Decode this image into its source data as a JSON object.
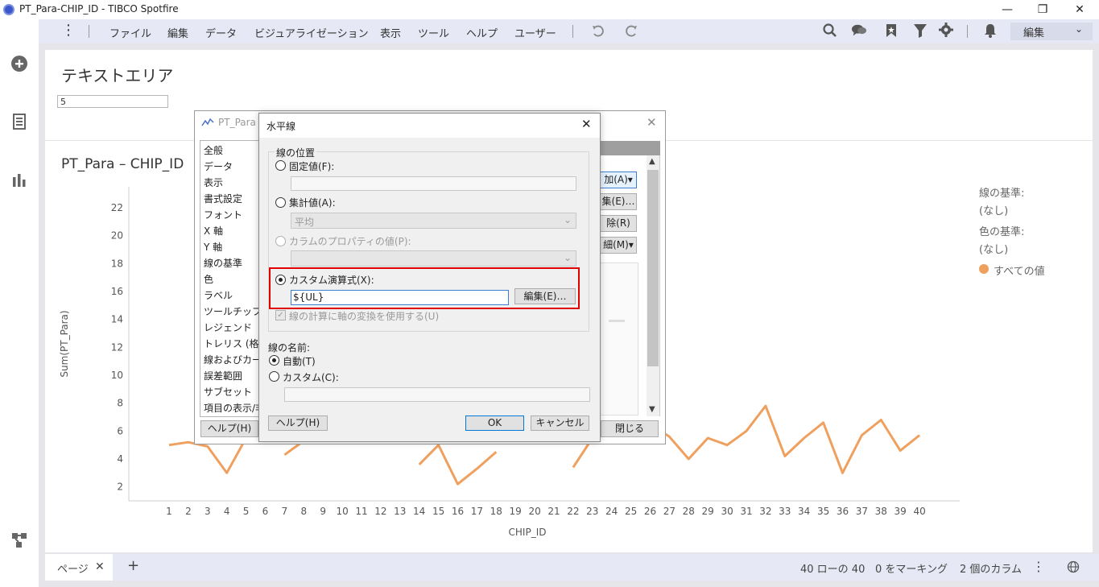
{
  "window": {
    "title": "PT_Para-CHIP_ID - TIBCO Spotfire"
  },
  "menu": {
    "items": [
      "ファイル",
      "編集",
      "データ",
      "ビジュアライゼーション",
      "表示",
      "ツール",
      "ヘルプ",
      "ユーザー"
    ],
    "mode": "編集"
  },
  "text_area": {
    "title": "テキストエリア",
    "input_value": "5"
  },
  "viz": {
    "title": "PT_Para – CHIP_ID"
  },
  "legend": {
    "line_by_label": "線の基準:",
    "line_by_value": "(なし)",
    "color_by_label": "色の基準:",
    "color_by_value": "(なし)",
    "all_values": "すべての値"
  },
  "chart_data": {
    "type": "line",
    "xlabel": "CHIP_ID",
    "ylabel": "Sum(PT_Para)",
    "x": [
      1,
      2,
      3,
      4,
      5,
      6,
      7,
      8,
      9,
      10,
      11,
      12,
      13,
      14,
      15,
      16,
      17,
      18,
      19,
      20,
      21,
      22,
      23,
      24,
      25,
      26,
      27,
      28,
      29,
      30,
      31,
      32,
      33,
      34,
      35,
      36,
      37,
      38,
      39,
      40
    ],
    "series": [
      {
        "values": [
          5.0,
          5.2,
          4.9,
          3.0,
          5.5,
          null,
          4.3,
          5.3,
          null,
          4.5,
          null,
          null,
          null,
          3.6,
          5.0,
          2.2,
          3.3,
          4.5,
          null,
          null,
          null,
          3.4,
          5.5,
          null,
          null,
          6.5,
          5.6,
          4.0,
          5.5,
          5.0,
          6.0,
          7.8,
          4.2,
          5.5,
          6.6,
          3.0,
          5.7,
          6.8,
          4.6,
          5.7
        ],
        "color": "#f0a05e"
      }
    ],
    "yticks": [
      2,
      4,
      6,
      8,
      10,
      12,
      14,
      16,
      18,
      20,
      22
    ],
    "ylim": [
      1,
      23.5
    ],
    "grid": false,
    "legend": "right"
  },
  "back_dialog": {
    "title": "PT_Para",
    "categories": [
      "全般",
      "データ",
      "表示",
      "書式設定",
      "フォント",
      "X 軸",
      "Y 軸",
      "線の基準",
      "色",
      "ラベル",
      "ツールチップ",
      "レジェンド",
      "トレリス (格子",
      "線およびカーブ",
      "誤差範囲",
      "サブセット",
      "項目の表示/非"
    ],
    "btn_add": "加(A)▾",
    "btn_edit": "集(E)…",
    "btn_delete": "除(R)",
    "btn_detail": "細(M)▾",
    "btn_help": "ヘルプ(H)",
    "btn_close": "閉じる"
  },
  "dialog": {
    "title": "水平線",
    "position_group": "線の位置",
    "fixed_value": "固定値(F):",
    "aggregated": "集計値(A):",
    "aggregated_select": "平均",
    "column_property": "カラムのプロパティの値(P):",
    "custom_expression": "カスタム演算式(X):",
    "expression_value": "${UL}",
    "edit_button": "編集(E)…",
    "use_axis_transform": "線の計算に軸の変換を使用する(U)",
    "line_name_group": "線の名前:",
    "auto": "自動(T)",
    "custom": "カスタム(C):",
    "help_button": "ヘルプ(H)",
    "ok_button": "OK",
    "cancel_button": "キャンセル"
  },
  "status": {
    "page_tab": "ページ",
    "rows": "40 ローの 40",
    "marking": "0 をマーキング",
    "columns": "2 個のカラム"
  }
}
